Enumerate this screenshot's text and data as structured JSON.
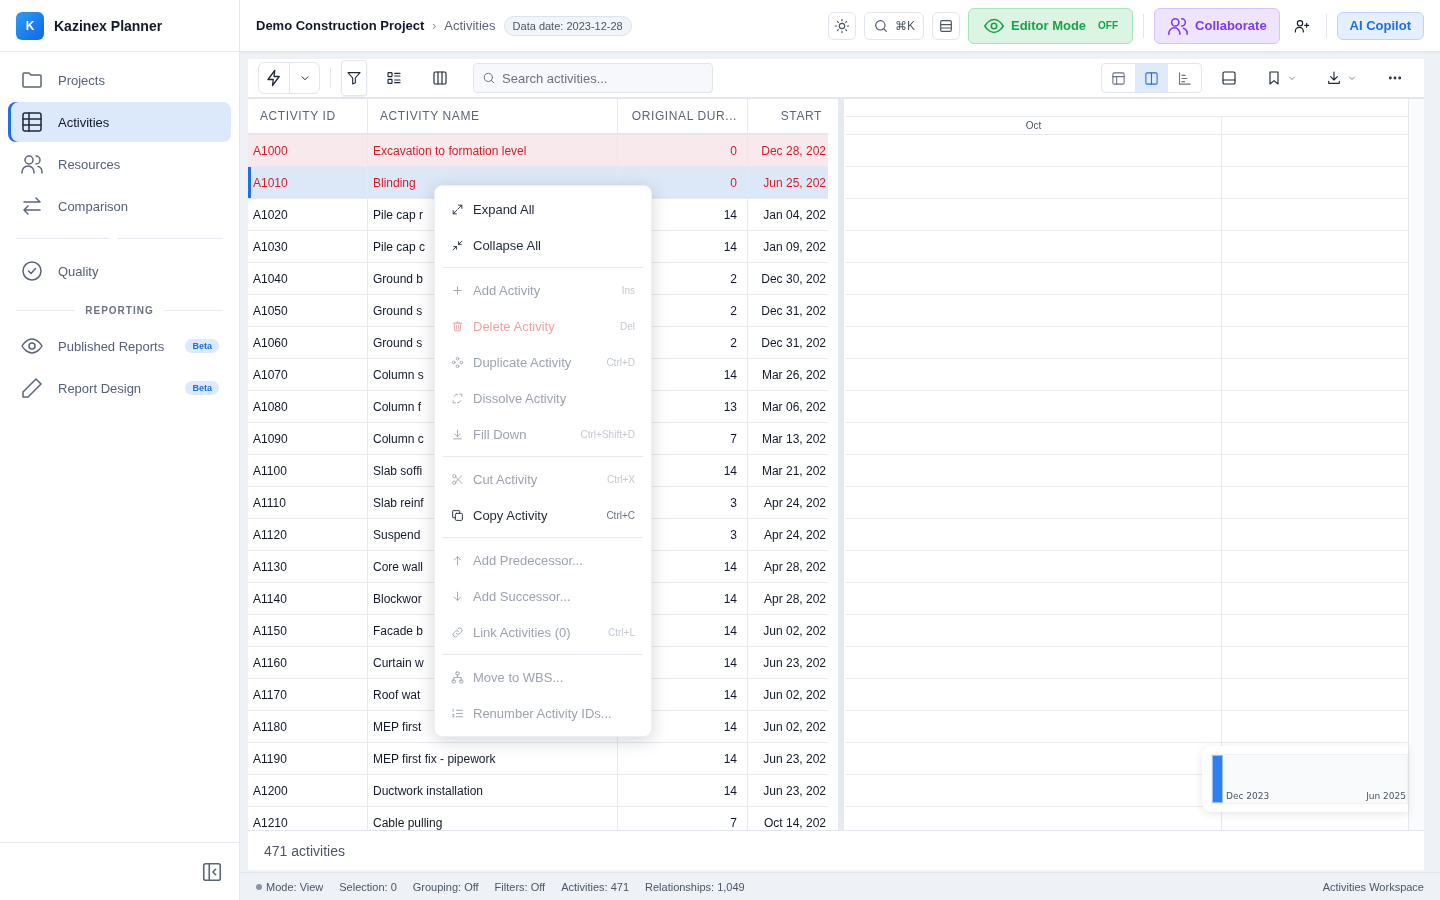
{
  "sidebar": {
    "brand": {
      "logo": "K",
      "name": "Kazinex Planner"
    },
    "items": [
      {
        "label": "Projects",
        "selected": false
      },
      {
        "label": "Activities",
        "selected": true
      },
      {
        "label": "Resources",
        "selected": false
      },
      {
        "label": "Comparison",
        "selected": false
      },
      {
        "label": "Quality",
        "selected": false
      }
    ],
    "section": "REPORTING",
    "report_items": [
      {
        "label": "Published Reports",
        "badge": "Beta"
      },
      {
        "label": "Report Design",
        "badge": "Beta"
      }
    ]
  },
  "header": {
    "breadcrumb": [
      "Demo Construction Project",
      "›",
      "Activities"
    ],
    "data_date": "Data date: 2023-12-28",
    "search_shortcut": "⌘K",
    "editor_mode": {
      "label": "Editor Mode",
      "state": "OFF",
      "on": false
    },
    "collaborate": "Collaborate",
    "copilot": "AI Copilot"
  },
  "toolbar": {
    "search": {
      "placeholder": "Search activities..."
    },
    "view_modes": [
      {
        "selected": false
      },
      {
        "selected": true
      },
      {
        "selected": false
      }
    ]
  },
  "table": {
    "columns": [
      "ACTIVITY ID",
      "ACTIVITY NAME",
      "ORIGINAL DUR...",
      "START"
    ],
    "rows": [
      {
        "id": "A1000",
        "name": "Excavation to formation level",
        "duration": "0",
        "start": "Dec 28, 202",
        "critical": true,
        "selected": false
      },
      {
        "id": "A1010",
        "name": "Blinding",
        "duration": "0",
        "start": "Jun 25, 202",
        "critical": true,
        "selected": true
      },
      {
        "id": "A1020",
        "name": "Pile cap r",
        "duration": "14",
        "start": "Jan 04, 202",
        "critical": false,
        "selected": false
      },
      {
        "id": "A1030",
        "name": "Pile cap c",
        "duration": "14",
        "start": "Jan 09, 202",
        "critical": false,
        "selected": false
      },
      {
        "id": "A1040",
        "name": "Ground b",
        "duration": "2",
        "start": "Dec 30, 202",
        "critical": false,
        "selected": false
      },
      {
        "id": "A1050",
        "name": "Ground s",
        "duration": "2",
        "start": "Dec 31, 202",
        "critical": false,
        "selected": false
      },
      {
        "id": "A1060",
        "name": "Ground s",
        "duration": "2",
        "start": "Dec 31, 202",
        "critical": false,
        "selected": false
      },
      {
        "id": "A1070",
        "name": "Column s",
        "duration": "14",
        "start": "Mar 26, 202",
        "critical": false,
        "selected": false
      },
      {
        "id": "A1080",
        "name": "Column f",
        "duration": "13",
        "start": "Mar 06, 202",
        "critical": false,
        "selected": false
      },
      {
        "id": "A1090",
        "name": "Column c",
        "duration": "7",
        "start": "Mar 13, 202",
        "critical": false,
        "selected": false
      },
      {
        "id": "A1100",
        "name": "Slab soffi",
        "duration": "14",
        "start": "Mar 21, 202",
        "critical": false,
        "selected": false
      },
      {
        "id": "A1110",
        "name": "Slab reinf",
        "duration": "3",
        "start": "Apr 24, 202",
        "critical": false,
        "selected": false
      },
      {
        "id": "A1120",
        "name": "Suspend",
        "duration": "3",
        "start": "Apr 24, 202",
        "critical": false,
        "selected": false
      },
      {
        "id": "A1130",
        "name": "Core wall",
        "duration": "14",
        "start": "Apr 28, 202",
        "critical": false,
        "selected": false
      },
      {
        "id": "A1140",
        "name": "Blockwor",
        "duration": "14",
        "start": "Apr 28, 202",
        "critical": false,
        "selected": false
      },
      {
        "id": "A1150",
        "name": "Facade b",
        "duration": "14",
        "start": "Jun 02, 202",
        "critical": false,
        "selected": false
      },
      {
        "id": "A1160",
        "name": "Curtain w",
        "duration": "14",
        "start": "Jun 23, 202",
        "critical": false,
        "selected": false
      },
      {
        "id": "A1170",
        "name": "Roof wat",
        "duration": "14",
        "start": "Jun 02, 202",
        "critical": false,
        "selected": false
      },
      {
        "id": "A1180",
        "name": "MEP first",
        "duration": "14",
        "start": "Jun 02, 202",
        "critical": false,
        "selected": false
      },
      {
        "id": "A1190",
        "name": "MEP first fix - pipework",
        "duration": "14",
        "start": "Jun 23, 202",
        "critical": false,
        "selected": false
      },
      {
        "id": "A1200",
        "name": "Ductwork installation",
        "duration": "14",
        "start": "Jun 23, 202",
        "critical": false,
        "selected": false
      },
      {
        "id": "A1210",
        "name": "Cable pulling",
        "duration": "7",
        "start": "Oct 14, 202",
        "critical": false,
        "selected": false
      }
    ],
    "count": "471 activities"
  },
  "gantt": {
    "month": "Oct",
    "minimap": {
      "start": "Dec 2023",
      "end": "Jun 2025"
    }
  },
  "context_menu": {
    "groups": [
      [
        {
          "label": "Expand All",
          "disabled": false,
          "danger": false
        },
        {
          "label": "Collapse All",
          "disabled": false,
          "danger": false
        }
      ],
      [
        {
          "label": "Add Activity",
          "shortcut": "Ins",
          "disabled": true,
          "danger": false
        },
        {
          "label": "Delete Activity",
          "shortcut": "Del",
          "disabled": true,
          "danger": true
        },
        {
          "label": "Duplicate Activity",
          "shortcut": "Ctrl+D",
          "disabled": true,
          "danger": false
        },
        {
          "label": "Dissolve Activity",
          "disabled": true,
          "danger": false
        },
        {
          "label": "Fill Down",
          "shortcut": "Ctrl+Shift+D",
          "disabled": true,
          "danger": false
        }
      ],
      [
        {
          "label": "Cut Activity",
          "shortcut": "Ctrl+X",
          "disabled": true,
          "danger": false
        },
        {
          "label": "Copy Activity",
          "shortcut": "Ctrl+C",
          "disabled": false,
          "danger": false
        }
      ],
      [
        {
          "label": "Add Predecessor...",
          "disabled": true,
          "danger": false
        },
        {
          "label": "Add Successor...",
          "disabled": true,
          "danger": false
        },
        {
          "label": "Link Activities (0)",
          "shortcut": "Ctrl+L",
          "disabled": true,
          "danger": false
        }
      ],
      [
        {
          "label": "Move to WBS...",
          "disabled": true,
          "danger": false
        },
        {
          "label": "Renumber Activity IDs...",
          "disabled": true,
          "danger": false
        }
      ]
    ]
  },
  "status_bar": {
    "items": [
      "Mode: View",
      "Selection: 0",
      "Grouping: Off",
      "Filters: Off",
      "Activities: 471",
      "Relationships: 1,049"
    ],
    "right": "Activities Workspace"
  }
}
